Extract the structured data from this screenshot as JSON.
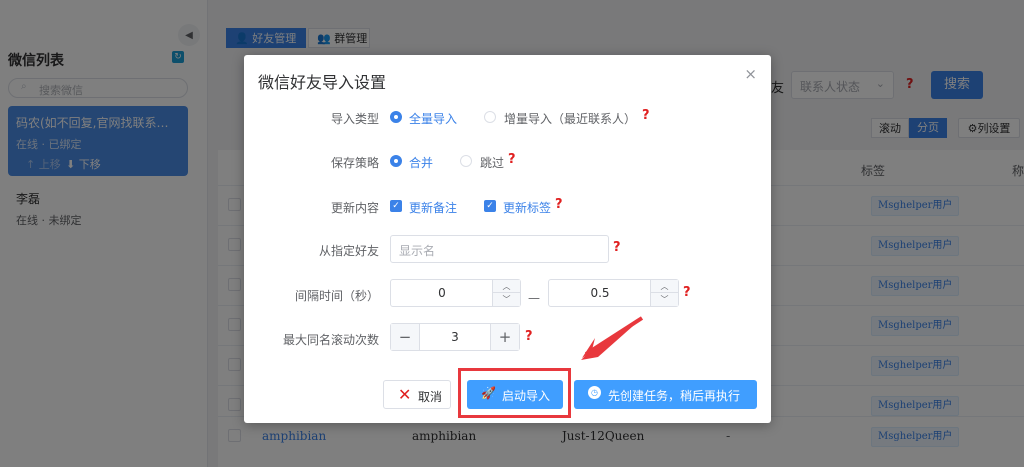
{
  "sidebar": {
    "title": "微信列表",
    "search_placeholder": "搜索微信",
    "contacts": [
      {
        "name": "码农(如不回复,官网找联系…",
        "status": "在线 · 已绑定",
        "move_up": "↑ 上移",
        "move_down": "⬇ 下移"
      },
      {
        "name": "李磊",
        "status": "在线 · 未绑定"
      }
    ]
  },
  "tabs": [
    {
      "label": "好友管理"
    },
    {
      "label": "群管理"
    }
  ],
  "toolbar": {
    "filter_label_fragment": "友",
    "status_placeholder": "联系人状态",
    "help_mark": "?",
    "search_button": "搜索",
    "view_scroll": "滚动",
    "view_page": "分页",
    "column_settings": "列设置"
  },
  "table": {
    "headers": {
      "tags": "标签",
      "more": "称"
    },
    "rows": [
      {
        "tag": "Msghelper用户"
      },
      {
        "tag": "Msghelper用户"
      },
      {
        "tag": "Msghelper用户"
      },
      {
        "tag": "Msghelper用户"
      },
      {
        "tag": "Msghelper用户"
      },
      {
        "tag": "Msghelper用户"
      },
      {
        "tag": "Msghelper用户"
      },
      {
        "name": "amphibian",
        "nickname": "amphibian",
        "wxid": "Just-12Queen",
        "remark": "-",
        "tag": "Msghelper用户"
      }
    ]
  },
  "dialog": {
    "title": "微信好友导入设置",
    "close": "×",
    "help_mark": "?",
    "fields": {
      "import_type": {
        "label": "导入类型",
        "opt1": "全量导入",
        "opt2": "增量导入（最近联系人）"
      },
      "save_strategy": {
        "label": "保存策略",
        "opt1": "合并",
        "opt2": "跳过"
      },
      "update_content": {
        "label": "更新内容",
        "opt1": "更新备注",
        "opt2": "更新标签"
      },
      "from_friend": {
        "label": "从指定好友",
        "placeholder": "显示名"
      },
      "interval": {
        "label": "间隔时间（秒）",
        "min": "0",
        "separator": "—",
        "max": "0.5"
      },
      "max_scroll": {
        "label": "最大同名滚动次数",
        "value": "3",
        "minus": "−",
        "plus": "+"
      }
    },
    "buttons": {
      "cancel": "取消",
      "start": "启动导入",
      "schedule": "先创建任务，稍后再执行"
    }
  },
  "colors": {
    "primary": "#409eff",
    "tab_active": "#3b82e8",
    "help": "#e02020",
    "annotation": "#e8383d"
  }
}
